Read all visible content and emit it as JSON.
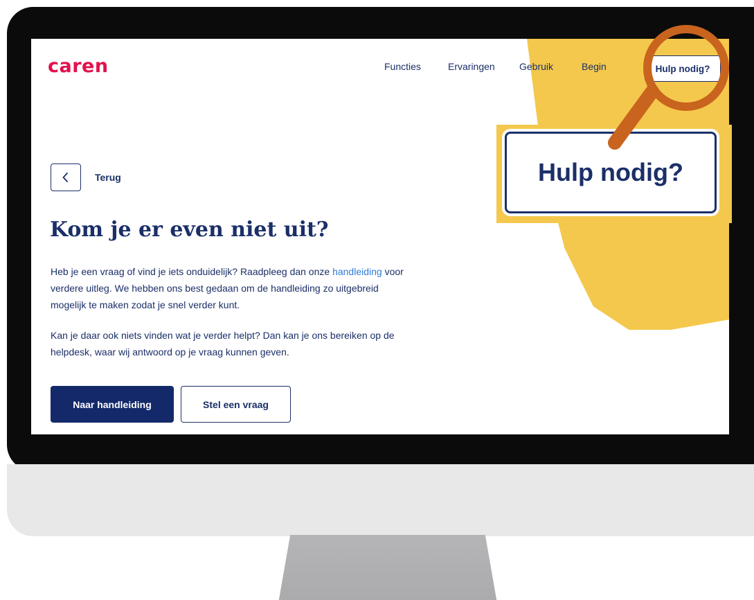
{
  "header": {
    "logo": "caren",
    "nav": [
      "Functies",
      "Ervaringen",
      "Gebruik",
      "Begin"
    ],
    "help_button": "Hulp nodig?"
  },
  "back": {
    "label": "Terug"
  },
  "main": {
    "title": "Kom je er even niet uit?",
    "paragraph1_before_link": "Heb je een vraag of vind je iets onduidelijk? Raadpleeg dan onze ",
    "paragraph1_link": "handleiding",
    "paragraph1_after_link": " voor verdere uitleg. We hebben ons best gedaan om de handleiding zo uitgebreid mogelijk te maken zodat je snel verder kunt.",
    "paragraph2": "Kan je daar ook niets vinden wat je verder helpt? Dan kan je ons bereiken op de helpdesk, waar wij antwoord op je vraag kunnen geven.",
    "primary_button": "Naar handleiding",
    "secondary_button": "Stel een vraag"
  },
  "callout": {
    "zoomed_label": "Hulp nodig?"
  },
  "colors": {
    "brand_red": "#e3104b",
    "navy": "#1b2f68",
    "accent_yellow": "#f4c84c",
    "link_blue": "#2f7bd8",
    "magnifier_orange": "#c8641e"
  },
  "icons": {
    "back": "chevron-left-icon",
    "magnifier": "magnifying-glass-icon"
  }
}
